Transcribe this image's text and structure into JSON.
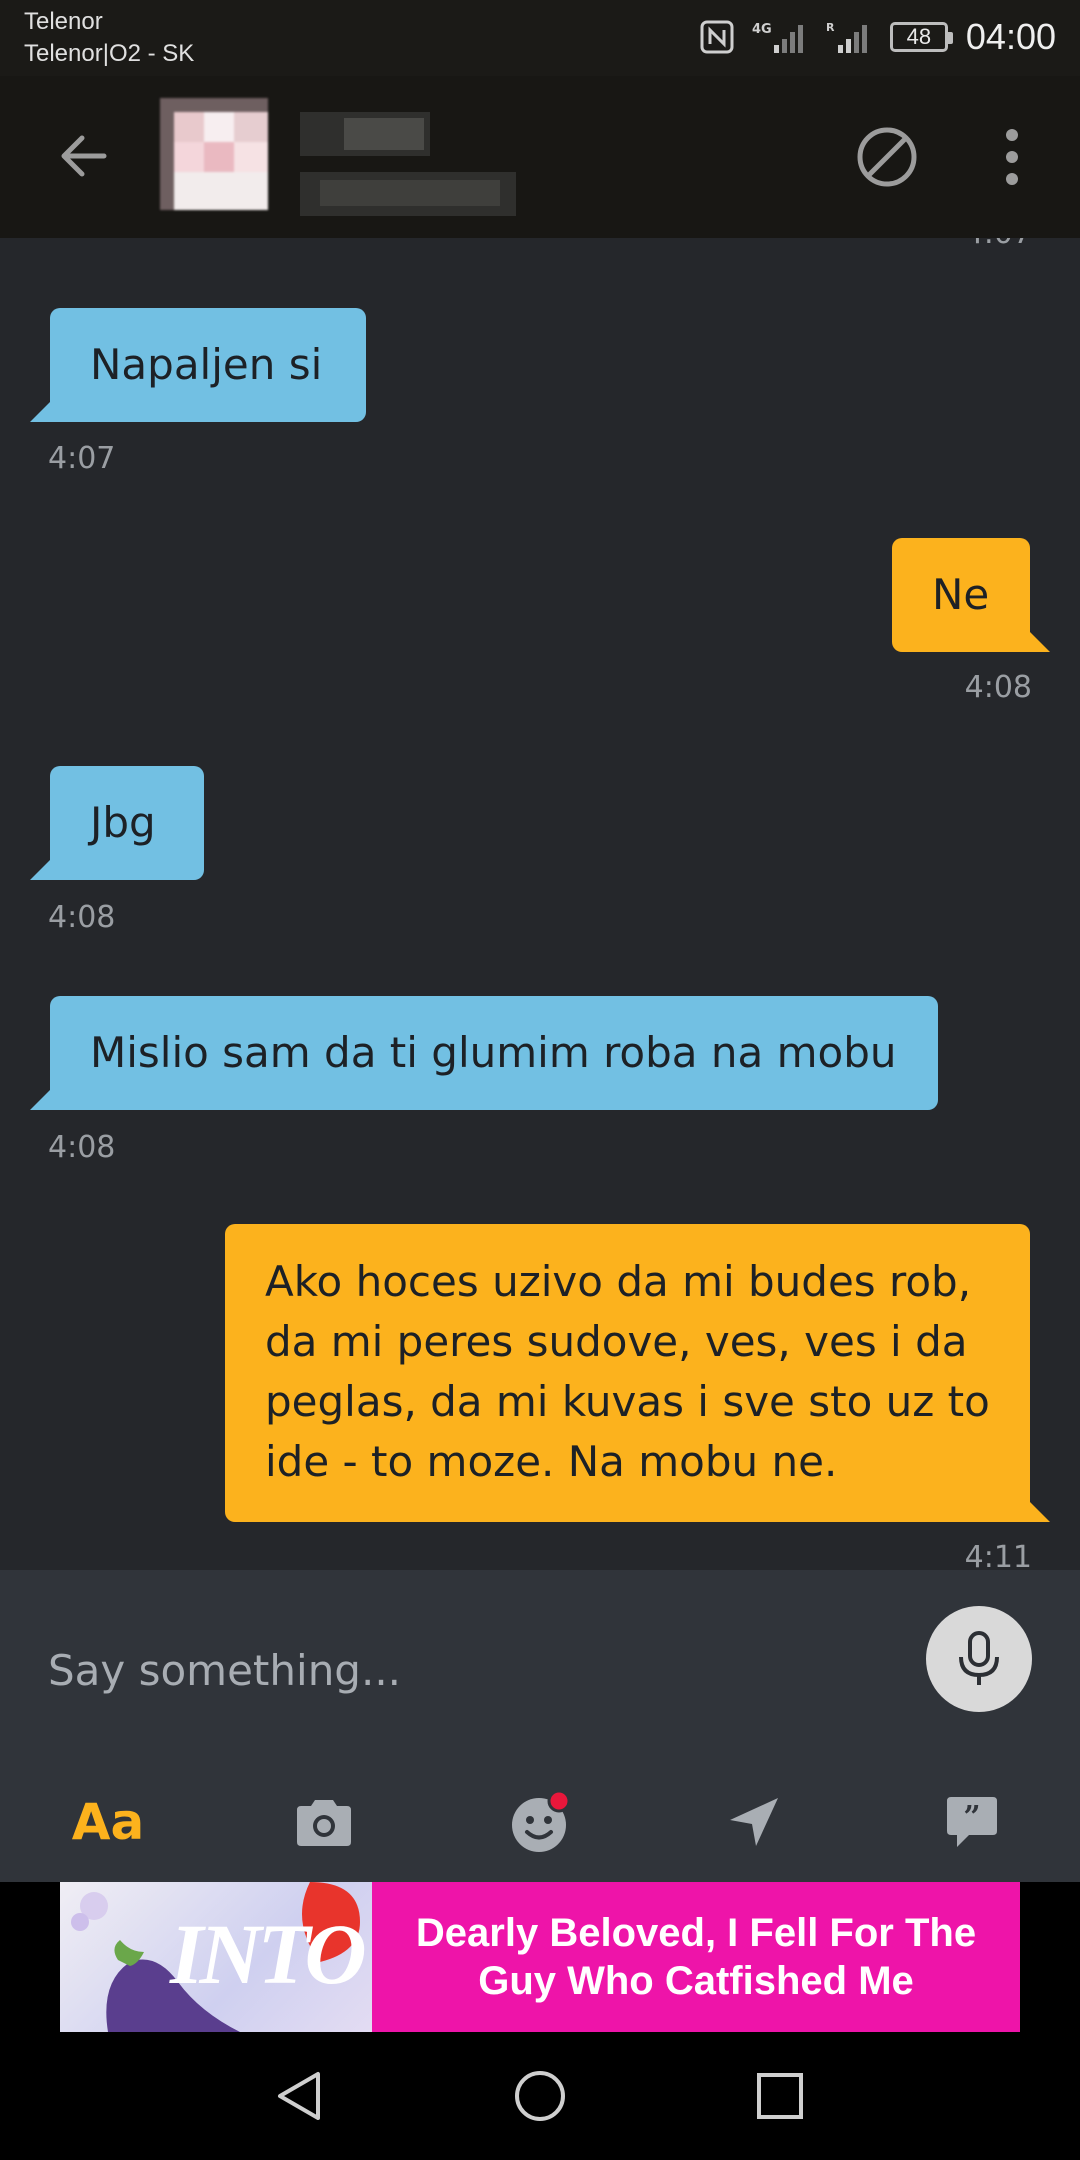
{
  "status_bar": {
    "carrier_1": "Telenor",
    "carrier_2": "Telenor|O2 - SK",
    "network": "4G",
    "roaming": "R",
    "battery": "48",
    "time": "04:00"
  },
  "header": {
    "back_icon": "arrow-left-icon",
    "block_icon": "block-icon",
    "more_icon": "more-vertical-icon"
  },
  "messages": [
    {
      "direction": "in",
      "text": "Napaljen si",
      "time": "4:07"
    },
    {
      "direction": "out",
      "text": "Ne",
      "time": "4:08"
    },
    {
      "direction": "in",
      "text": "Jbg",
      "time": "4:08"
    },
    {
      "direction": "in",
      "text": "Mislio sam da ti glumim roba na mobu",
      "time": "4:08"
    },
    {
      "direction": "out",
      "text": "Ako hoces uzivo da mi budes rob, da mi peres sudove, ves, ves i da peglas, da mi kuvas i sve sto uz to ide - to moze. Na mobu ne.",
      "time": "4:11"
    }
  ],
  "composer": {
    "placeholder": "Say something...",
    "mic_icon": "microphone-icon"
  },
  "toolbar": {
    "aa_label": "Aa",
    "camera_icon": "camera-icon",
    "sticker_icon": "sticker-icon",
    "location_icon": "send-location-icon",
    "phrases_icon": "saved-phrases-icon"
  },
  "ad": {
    "logo": "INTO",
    "text": "Dearly Beloved, I Fell For The Guy Who Catfished Me"
  },
  "colors": {
    "incoming_bubble": "#72c0e3",
    "outgoing_bubble": "#fcb21d",
    "chat_background": "#25272b",
    "accent": "#fcb21d",
    "ad_pink": "#ee14a9",
    "notification_dot": "#e8173b"
  }
}
